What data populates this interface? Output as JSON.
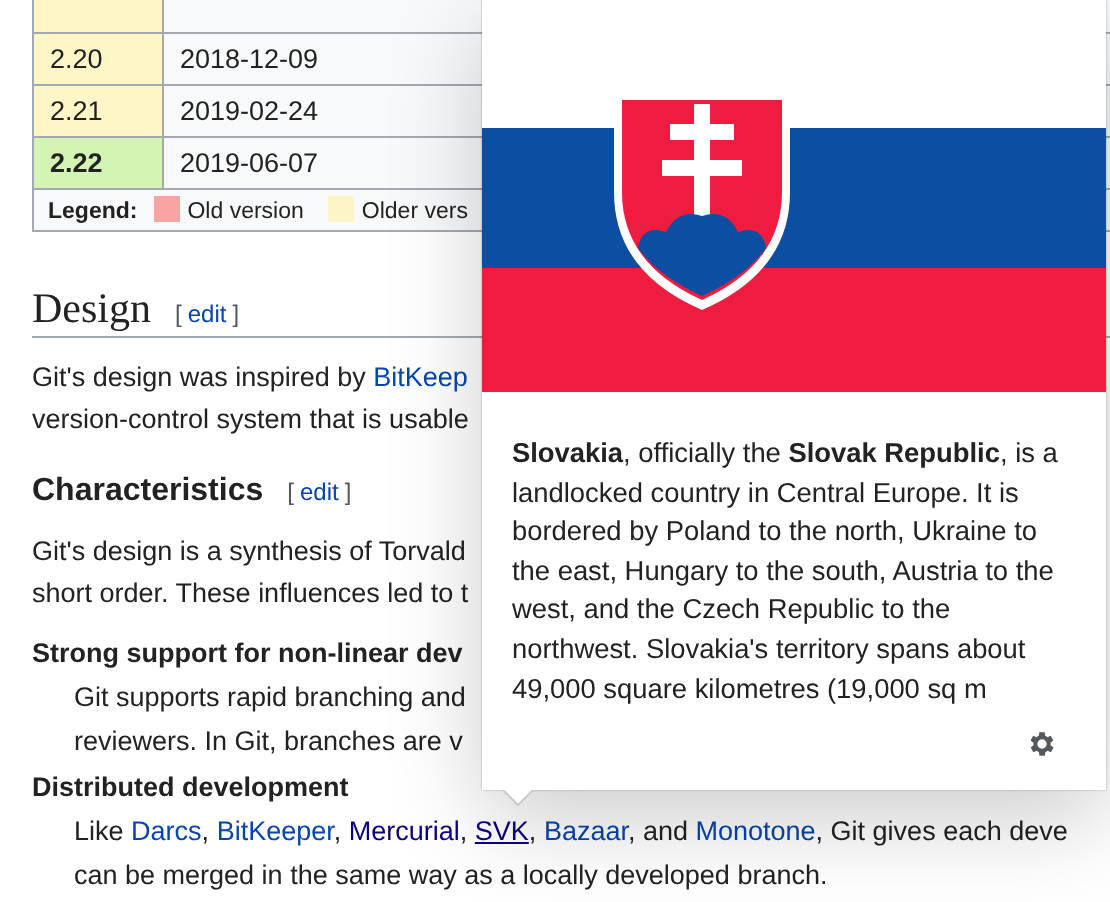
{
  "version_table": {
    "rows": [
      {
        "version": "2.20",
        "date": "2018-12-09",
        "color": "#fef6c7",
        "latest": false
      },
      {
        "version": "2.21",
        "date": "2019-02-24",
        "color": "#fef6c7",
        "latest": false
      },
      {
        "version": "2.22",
        "date": "2019-06-07",
        "color": "#d4f4b4",
        "latest": true
      }
    ],
    "legend": {
      "label": "Legend:",
      "items": [
        {
          "label": "Old version",
          "color": "#f9a3a3"
        },
        {
          "label": "Older vers",
          "color": "#fef5c6"
        }
      ]
    }
  },
  "design": {
    "heading": "Design",
    "edit": {
      "open": "[",
      "label": "edit",
      "close": "]"
    },
    "lines": [
      [
        {
          "kind": "plain",
          "text": "Git's design was inspired by "
        },
        {
          "kind": "link",
          "text": "BitKeep"
        }
      ],
      [
        {
          "kind": "plain",
          "text": "version-control system that is usable"
        }
      ]
    ]
  },
  "characteristics": {
    "heading": "Characteristics",
    "edit": {
      "open": "[",
      "label": "edit",
      "close": "]"
    },
    "lines": [
      [
        {
          "kind": "plain",
          "text": "Git's design is a synthesis of Torvald"
        }
      ],
      [
        {
          "kind": "plain",
          "text": "short order. These influences led to t"
        }
      ]
    ]
  },
  "terms": [
    {
      "term": "Strong support for non-linear dev",
      "lines": [
        [
          {
            "kind": "plain",
            "text": "Git supports rapid branching and"
          }
        ],
        [
          {
            "kind": "plain",
            "text": "reviewers. In Git, branches are v"
          }
        ]
      ]
    },
    {
      "term": "Distributed development",
      "lines": [
        [
          {
            "kind": "plain",
            "text": "Like "
          },
          {
            "kind": "link",
            "text": "Darcs"
          },
          {
            "kind": "plain",
            "text": ", "
          },
          {
            "kind": "link",
            "text": "BitKeeper"
          },
          {
            "kind": "plain",
            "text": ", "
          },
          {
            "kind": "visited",
            "text": "Mercurial"
          },
          {
            "kind": "plain",
            "text": ", "
          },
          {
            "kind": "hover",
            "text": "SVK"
          },
          {
            "kind": "plain",
            "text": ", "
          },
          {
            "kind": "link",
            "text": "Bazaar"
          },
          {
            "kind": "plain",
            "text": ", and "
          },
          {
            "kind": "link",
            "text": "Monotone"
          },
          {
            "kind": "plain",
            "text": ", Git gives each deve"
          }
        ],
        [
          {
            "kind": "plain",
            "text": "can be merged in the same way as a locally developed branch."
          }
        ]
      ]
    }
  ],
  "preview": {
    "extract": "**Slovakia**, officially the **Slovak Republic**, is a landlocked country in Central Europe. It is bordered by Poland to the north, Ukraine to the east, Hungary to the south, Austria to the west, and the Czech Republic to the northwest. Slovakia's territory spans about 49,000 square kilometres (19,000 sq m"
  }
}
